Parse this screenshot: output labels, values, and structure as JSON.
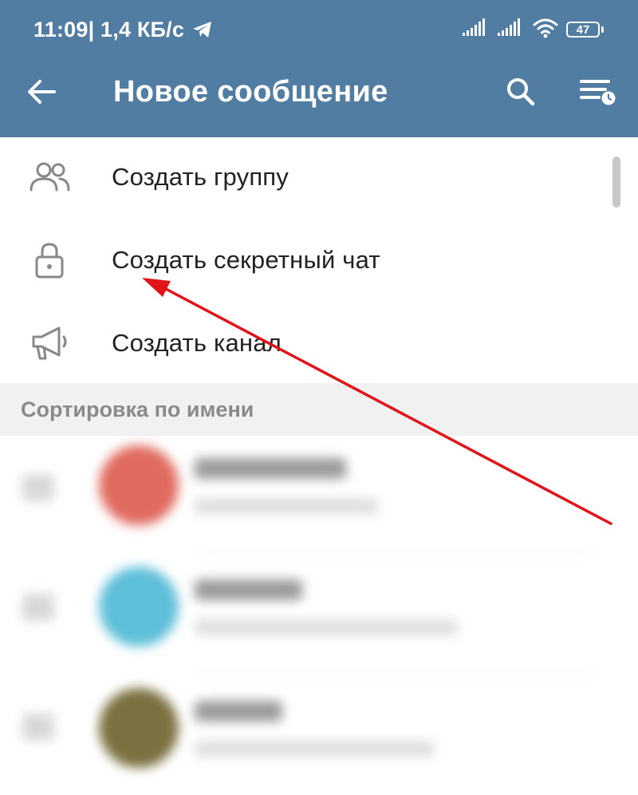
{
  "status_bar": {
    "time": "11:09",
    "speed": " | 1,4 КБ/с",
    "battery": "47"
  },
  "toolbar": {
    "title": "Новое сообщение"
  },
  "menu": {
    "items": [
      {
        "label": "Создать группу",
        "icon": "group-icon"
      },
      {
        "label": "Создать секретный чат",
        "icon": "lock-icon"
      },
      {
        "label": "Создать канал",
        "icon": "megaphone-icon"
      }
    ]
  },
  "section_header": "Сортировка по имени",
  "colors": {
    "app_bar": "#517da2",
    "arrow": "#e0141a",
    "avatar_1": "#e06a5e",
    "avatar_2": "#5ebfd9",
    "avatar_3": "#7a7040"
  }
}
